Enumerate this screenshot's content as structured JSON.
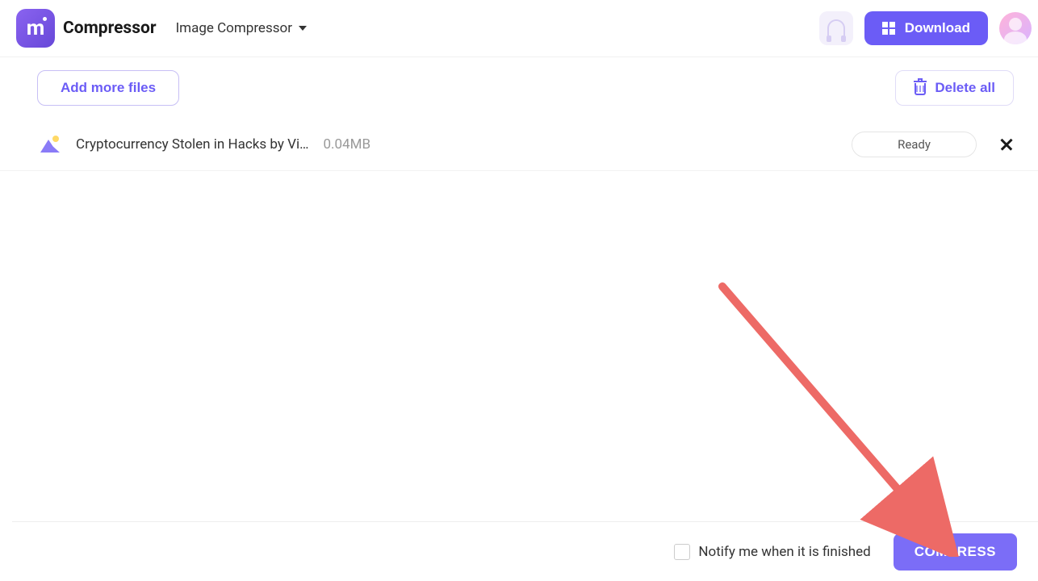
{
  "header": {
    "app_title": "Compressor",
    "mode_label": "Image Compressor",
    "download_label": "Download"
  },
  "toolbar": {
    "add_label": "Add more files",
    "delete_label": "Delete all"
  },
  "files": [
    {
      "name": "Cryptocurrency Stolen in Hacks by Vi…",
      "size": "0.04MB",
      "status": "Ready"
    }
  ],
  "footer": {
    "notify_label": "Notify me when it is finished",
    "compress_label": "COMPRESS"
  },
  "colors": {
    "primary": "#6b5cf6",
    "arrow": "#ed6a66"
  }
}
